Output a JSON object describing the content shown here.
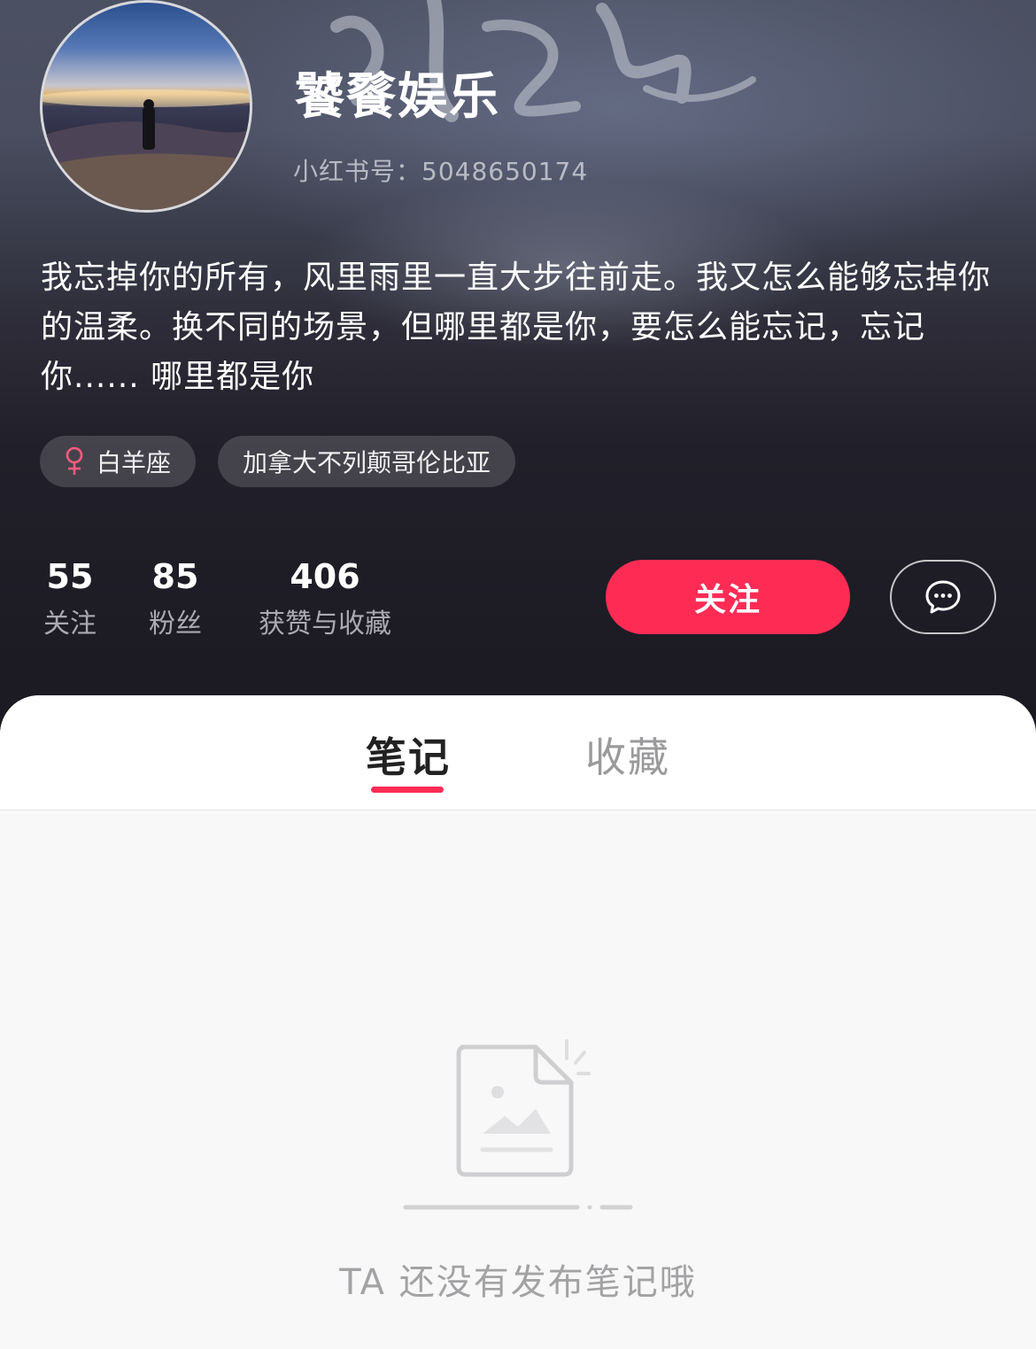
{
  "profile": {
    "name": "饕餮娱乐",
    "redbook_id": "小红书号：5048650174",
    "bio": "我忘掉你的所有，风里雨里一直大步往前走。我又怎么能够忘掉你的温柔。换不同的场景，但哪里都是你，要怎么能忘记，忘记你...... 哪里都是你",
    "tags": [
      {
        "icon": "female-icon",
        "label": "白羊座"
      },
      {
        "icon": "",
        "label": "加拿大不列颠哥伦比亚"
      }
    ]
  },
  "stats": {
    "following": {
      "value": "55",
      "label": "关注"
    },
    "followers": {
      "value": "85",
      "label": "粉丝"
    },
    "likes": {
      "value": "406",
      "label": "获赞与收藏"
    }
  },
  "actions": {
    "follow_label": "关注",
    "message_icon": "chat-bubble-icon"
  },
  "tabs": {
    "notes": "笔记",
    "collections": "收藏",
    "active": "notes"
  },
  "empty_state": {
    "icon": "empty-document-icon",
    "message": "TA 还没有发布笔记哦"
  },
  "colors": {
    "accent": "#fe2c55",
    "background_dark": "#1b1a22",
    "content_bg": "#f8f8f8",
    "female_icon": "#ff5b7f"
  }
}
